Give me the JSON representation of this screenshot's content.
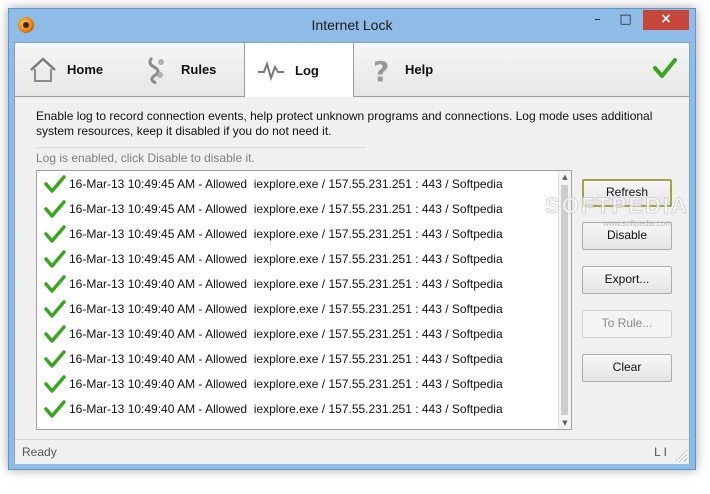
{
  "window": {
    "title": "Internet Lock",
    "close_symbol": "×",
    "minimize_symbol": "–",
    "maximize_symbol": "□"
  },
  "tabs": [
    {
      "label": "Home",
      "icon": "home-icon"
    },
    {
      "label": "Rules",
      "icon": "rules-icon"
    },
    {
      "label": "Log",
      "icon": "log-pulse-icon",
      "selected": true
    },
    {
      "label": "Help",
      "icon": "help-icon"
    }
  ],
  "description": "Enable log to record connection events, help protect unknown programs and connections. Log mode uses additional system resources, keep it disabled if you do not need it.",
  "log_status": "Log is enabled, click Disable to disable it.",
  "log_entries": [
    "16-Mar-13 10:49:45 AM - Allowed  iexplore.exe / 157.55.231.251 : 443 / Softpedia",
    "16-Mar-13 10:49:45 AM - Allowed  iexplore.exe / 157.55.231.251 : 443 / Softpedia",
    "16-Mar-13 10:49:45 AM - Allowed  iexplore.exe / 157.55.231.251 : 443 / Softpedia",
    "16-Mar-13 10:49:45 AM - Allowed  iexplore.exe / 157.55.231.251 : 443 / Softpedia",
    "16-Mar-13 10:49:40 AM - Allowed  iexplore.exe / 157.55.231.251 : 443 / Softpedia",
    "16-Mar-13 10:49:40 AM - Allowed  iexplore.exe / 157.55.231.251 : 443 / Softpedia",
    "16-Mar-13 10:49:40 AM - Allowed  iexplore.exe / 157.55.231.251 : 443 / Softpedia",
    "16-Mar-13 10:49:40 AM - Allowed  iexplore.exe / 157.55.231.251 : 443 / Softpedia",
    "16-Mar-13 10:49:40 AM - Allowed  iexplore.exe / 157.55.231.251 : 443 / Softpedia",
    "16-Mar-13 10:49:40 AM - Allowed  iexplore.exe / 157.55.231.251 : 443 / Softpedia"
  ],
  "buttons": {
    "refresh": "Refresh",
    "disable": "Disable",
    "export": "Export...",
    "to_rule": "To Rule...",
    "clear": "Clear"
  },
  "statusbar": {
    "text": "Ready",
    "indicator": "L I"
  },
  "watermark": {
    "text": "SOFTPEDIA",
    "sub": "www.softpedia.com"
  },
  "colors": {
    "titlebar": "#8fbce6",
    "close": "#c7463a",
    "check": "#3aa51e",
    "default_button_border": "#9fa34a"
  }
}
